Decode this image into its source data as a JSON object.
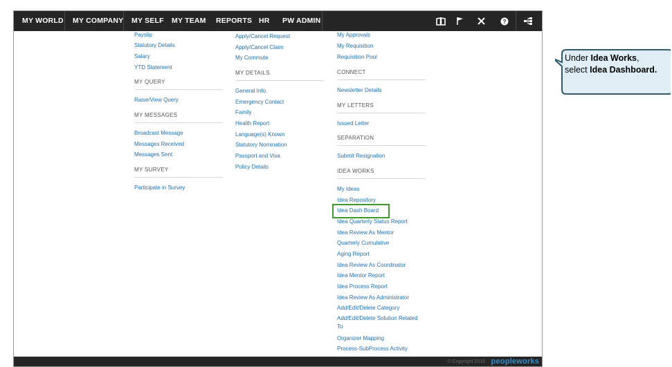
{
  "nav": {
    "items": [
      "MY WORLD",
      "MY COMPANY",
      "MY SELF",
      "MY TEAM",
      "REPORTS",
      "HR",
      "PW ADMIN"
    ],
    "icons": [
      "book-icon",
      "flag-icon",
      "tools-icon",
      "help-icon",
      "sitemap-icon"
    ]
  },
  "col1": {
    "items": [
      "Payslip",
      "Statutory Details",
      "Salary",
      "YTD Statement"
    ],
    "sec_query": "MY QUERY",
    "query_items": [
      "Raise/View Query"
    ],
    "sec_messages": "MY MESSAGES",
    "message_items": [
      "Broadcast Message",
      "Messages Received",
      "Messages Sent"
    ],
    "sec_survey": "MY SURVEY",
    "survey_items": [
      "Participate in Survey"
    ]
  },
  "col2": {
    "items": [
      "Apply/Cancel Request",
      "Apply/Cancel Claim",
      "My Commute"
    ],
    "sec_details": "MY DETAILS",
    "detail_items": [
      "General Info.",
      "Emergency Contact",
      "Family",
      "Health Report",
      "Language(s) Known",
      "Statutory Nomination",
      "Passport and Visa",
      "Policy Details"
    ]
  },
  "col3": {
    "items": [
      "My Approvals",
      "My Requisition",
      "Requisition Pool"
    ],
    "sec_connect": "CONNECT",
    "connect_items": [
      "Newsletter Details"
    ],
    "sec_letters": "MY LETTERS",
    "letter_items": [
      "Issued Letter"
    ],
    "sec_separation": "SEPARATION",
    "separation_items": [
      "Submit Resignation"
    ],
    "sec_ideaworks": "IDEA WORKS",
    "idea_items": [
      "My Ideas",
      "Idea Repository",
      "Idea Dash Board",
      "Idea Quarterly Status Report",
      "Idea Review As Mentor",
      "Quarterly Cumulative",
      "Aging Report",
      "Idea Review As Coordinator",
      "Idea Mentor Report",
      "Idea Process Report",
      "Idea Review As Administrator",
      "Add/Edit/Delete Category",
      "Add/Edit/Delete Solution Related To",
      "Organizer Mapping",
      "Process-SubProcess Activity"
    ]
  },
  "footer": {
    "copyright": "© Copyright 2015",
    "brand": "peopleworks"
  },
  "callout": {
    "t1": "Under ",
    "b1": "Idea Works",
    "t2": ", select ",
    "b2": "Idea Dashboard."
  },
  "colors": {
    "navbar": "#262626",
    "link": "#1f6fb4",
    "highlight": "#3e9b2b",
    "callout_fill": "#dfeef5",
    "callout_border": "#2f5b68"
  }
}
